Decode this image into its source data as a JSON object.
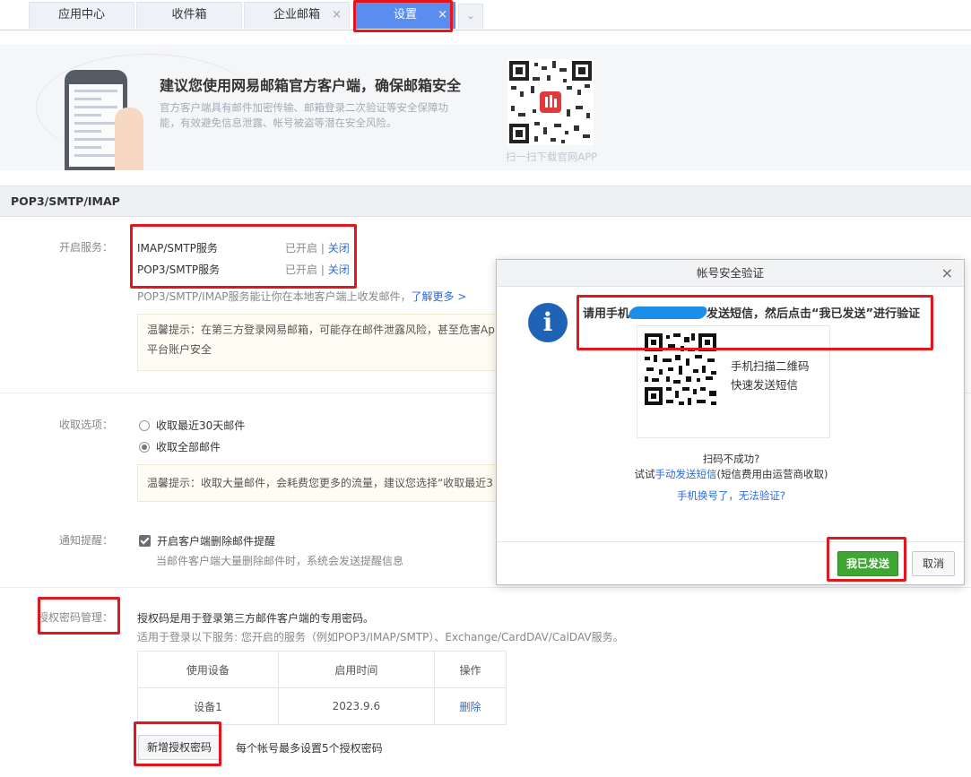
{
  "tabs": [
    {
      "label": "应用中心"
    },
    {
      "label": "收件箱"
    },
    {
      "label": "企业邮箱",
      "close": "×"
    },
    {
      "label": "设置",
      "close": "×"
    }
  ],
  "tab_more": "⌄",
  "banner": {
    "title": "建议您使用网易邮箱官方客户端，确保邮箱安全",
    "desc": "官方客户端具有邮件加密传输、邮箱登录二次验证等安全保障功能，有效避免信息泄露、帐号被盗等潜在安全风险。",
    "qr_caption": "扫一扫下载官网APP"
  },
  "section_title": "POP3/SMTP/IMAP",
  "services": {
    "label": "开启服务：",
    "items": [
      {
        "name": "IMAP/SMTP服务",
        "status": "已开启",
        "sep": "|",
        "action": "关闭"
      },
      {
        "name": "POP3/SMTP服务",
        "status": "已开启",
        "sep": "|",
        "action": "关闭"
      }
    ],
    "desc": "POP3/SMTP/IMAP服务能让你在本地客户端上收发邮件，",
    "learn_more": "了解更多 >",
    "tip": "温馨提示：在第三方登录网易邮箱，可能存在邮件泄露风险，甚至危害Ap",
    "tip2": "平台账户安全"
  },
  "receive": {
    "label": "收取选项：",
    "options": [
      "收取最近30天邮件",
      "收取全部邮件"
    ],
    "selected": 1,
    "tip": "温馨提示：收取大量邮件，会耗费您更多的流量，建议您选择“收取最近3"
  },
  "notify": {
    "label": "通知提醒：",
    "checkbox": "开启客户端删除邮件提醒",
    "checked": true,
    "desc": "当邮件客户端大量删除邮件时，系统会发送提醒信息"
  },
  "auth": {
    "label": "授权密码管理：",
    "desc1": "授权码是用于登录第三方邮件客户端的专用密码。",
    "desc2": "适用于登录以下服务: 您开启的服务（例如POP3/IMAP/SMTP）、Exchange/CardDAV/CalDAV服务。",
    "table": {
      "headers": [
        "使用设备",
        "启用时间",
        "操作"
      ],
      "rows": [
        [
          "设备1",
          "2023.9.6",
          "删除"
        ]
      ]
    },
    "add_button": "新增授权密码",
    "add_hint": "每个帐号最多设置5个授权密码"
  },
  "dialog": {
    "title": "帐号安全验证",
    "close": "×",
    "info_glyph": "i",
    "msg_prefix": "请用手机",
    "msg_suffix": "发送短信，然后点击“我已发送”进行验证",
    "qr_text1": "手机扫描二维码",
    "qr_text2": "快速发送短信",
    "scan_fail": "扫码不成功?",
    "manual_prefix": "试试",
    "manual_link": "手动发送短信",
    "manual_suffix": "(短信费用由运营商收取)",
    "changed_phone": "手机换号了，无法验证?",
    "ok_button": "我已发送",
    "cancel_button": "取消"
  },
  "colors": {
    "accent": "#5a8df0",
    "highlight": "#e4151b",
    "ok": "#3fa533",
    "link": "#2f6bd8"
  }
}
